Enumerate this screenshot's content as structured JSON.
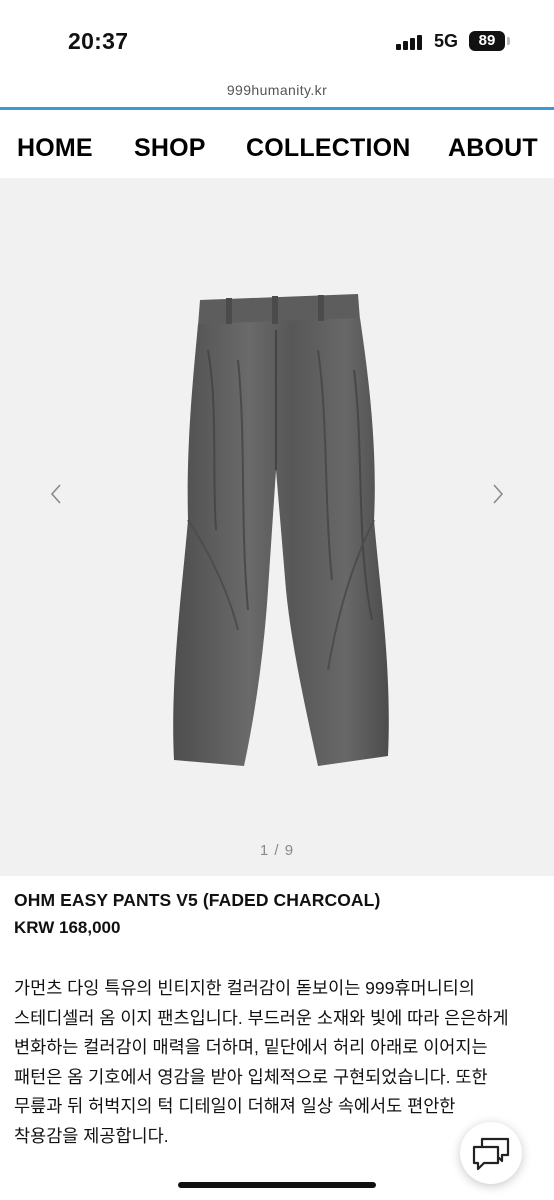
{
  "status_bar": {
    "time": "20:37",
    "network": "5G",
    "battery": "89"
  },
  "browser": {
    "url": "999humanity.kr"
  },
  "nav": {
    "home": "HOME",
    "shop": "SHOP",
    "collection": "COLLECTION",
    "about": "ABOUT"
  },
  "gallery": {
    "counter": "1 / 9",
    "prev_icon": "chevron-left-icon",
    "next_icon": "chevron-right-icon",
    "product_image": "faded-charcoal-wide-pants-photo",
    "background": "#f1f1f1"
  },
  "product": {
    "title": "OHM EASY PANTS V5 (FADED CHARCOAL)",
    "price": "KRW 168,000",
    "description_lines": [
      "가먼츠 다잉 특유의 빈티지한 컬러감이 돋보이는 999휴머니티의",
      "스테디셀러 옴 이지 팬츠입니다. 부드러운 소재와 빛에 따라 은은하게",
      "변화하는 컬러감이 매력을 더하며, 밑단에서 허리 아래로 이어지는",
      "패턴은 옴 기호에서 영감을 받아 입체적으로 구현되었습니다. 또한",
      "무릎과 뒤 허벅지의 턱 디테일이 더해져 일상 속에서도 편안한",
      "착용감을 제공합니다."
    ]
  },
  "chat": {
    "icon": "chat-bubbles-icon"
  },
  "colors": {
    "accent": "#3a9ad9",
    "pants": "#585858",
    "text": "#111111"
  }
}
